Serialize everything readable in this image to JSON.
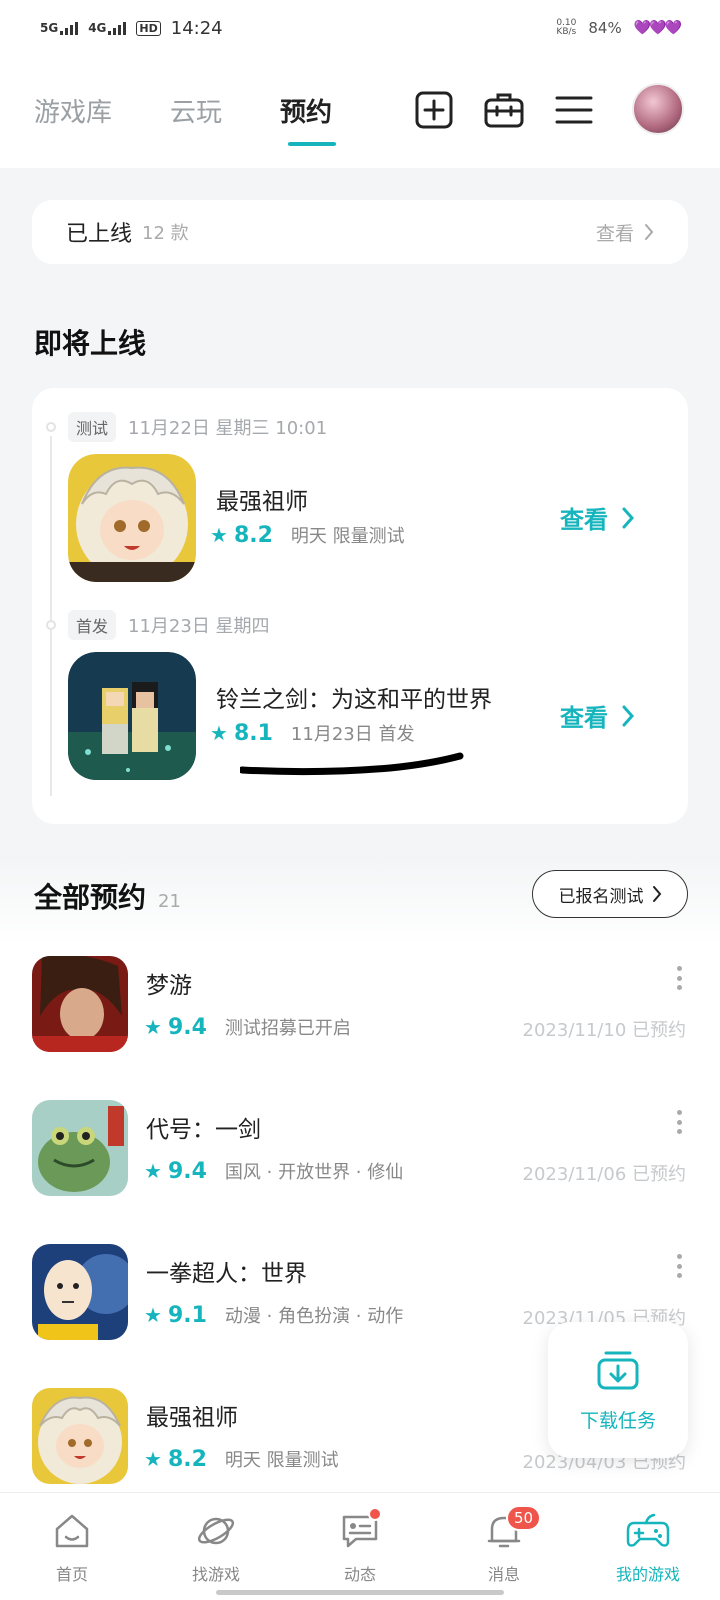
{
  "status_bar": {
    "net1": "5G",
    "net2": "4G",
    "hd": "HD",
    "time": "14:24",
    "speed_value": "0.10",
    "speed_unit": "KB/s",
    "battery": "84%",
    "hearts": "💜💜💜"
  },
  "top_nav": {
    "tabs": [
      "游戏库",
      "云玩",
      "预约"
    ],
    "active_tab": "预约"
  },
  "online": {
    "label": "已上线",
    "count": "12 款",
    "view": "查看"
  },
  "upcoming": {
    "title": "即将上线",
    "items": [
      {
        "tag": "测试",
        "date": "11月22日 星期三 10:01",
        "name": "最强祖师",
        "score": "8.2",
        "meta": "明天 限量测试",
        "action": "查看"
      },
      {
        "tag": "首发",
        "date": "11月23日 星期四",
        "name": "铃兰之剑：为这和平的世界",
        "score": "8.1",
        "meta": "11月23日 首发",
        "action": "查看"
      }
    ]
  },
  "all_reservations": {
    "title": "全部预约",
    "count": "21",
    "registered_button": "已报名测试",
    "items": [
      {
        "name": "梦游",
        "score": "9.4",
        "meta": "测试招募已开启",
        "date": "2023/11/10 已预约"
      },
      {
        "name": "代号：一剑",
        "score": "9.4",
        "meta": "国风 · 开放世界 · 修仙",
        "date": "2023/11/06 已预约"
      },
      {
        "name": "一拳超人：世界",
        "score": "9.1",
        "meta": "动漫 · 角色扮演 · 动作",
        "date": "2023/11/05 已预约"
      },
      {
        "name": "最强祖师",
        "score": "8.2",
        "meta": "明天 限量测试",
        "date": "2023/04/03 已预约"
      }
    ]
  },
  "download_fab": {
    "label": "下载任务"
  },
  "bottom_nav": {
    "items": [
      {
        "label": "首页"
      },
      {
        "label": "找游戏"
      },
      {
        "label": "动态"
      },
      {
        "label": "消息",
        "badge": "50"
      },
      {
        "label": "我的游戏"
      }
    ],
    "active": "我的游戏"
  },
  "colors": {
    "accent": "#16b5bd",
    "badge": "#f0554b"
  }
}
